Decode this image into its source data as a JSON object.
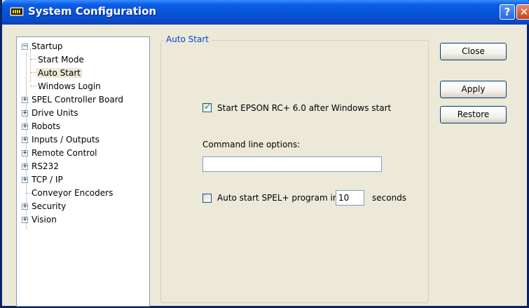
{
  "window": {
    "title": "System Configuration",
    "help_glyph": "?",
    "close_glyph": "✕",
    "icons": {
      "app": "app-icon",
      "help": "help-icon",
      "close": "close-icon"
    }
  },
  "tree": {
    "items": [
      {
        "label": "Startup",
        "expander": "⊟"
      },
      {
        "label": "Start Mode"
      },
      {
        "label": "Auto Start",
        "selected": true
      },
      {
        "label": "Windows Login"
      },
      {
        "label": "SPEL Controller Board",
        "expander": "⊞"
      },
      {
        "label": "Drive Units",
        "expander": "⊞"
      },
      {
        "label": "Robots",
        "expander": "⊞"
      },
      {
        "label": "Inputs / Outputs",
        "expander": "⊞"
      },
      {
        "label": "Remote Control",
        "expander": "⊞"
      },
      {
        "label": "RS232",
        "expander": "⊞"
      },
      {
        "label": "TCP / IP",
        "expander": "⊞"
      },
      {
        "label": "Conveyor Encoders"
      },
      {
        "label": "Security",
        "expander": "⊞"
      },
      {
        "label": "Vision",
        "expander": "⊞"
      }
    ]
  },
  "panel": {
    "group_title": "Auto Start",
    "start_checkbox": {
      "label": "Start EPSON RC+ 6.0 after Windows start",
      "checked": true
    },
    "command_line": {
      "label": "Command line options:",
      "value": ""
    },
    "auto_start_checkbox": {
      "label": "Auto start SPEL+ program in",
      "checked": false
    },
    "seconds_value": "10",
    "seconds_label": "seconds"
  },
  "buttons": {
    "close": "Close",
    "apply": "Apply",
    "restore": "Restore"
  }
}
